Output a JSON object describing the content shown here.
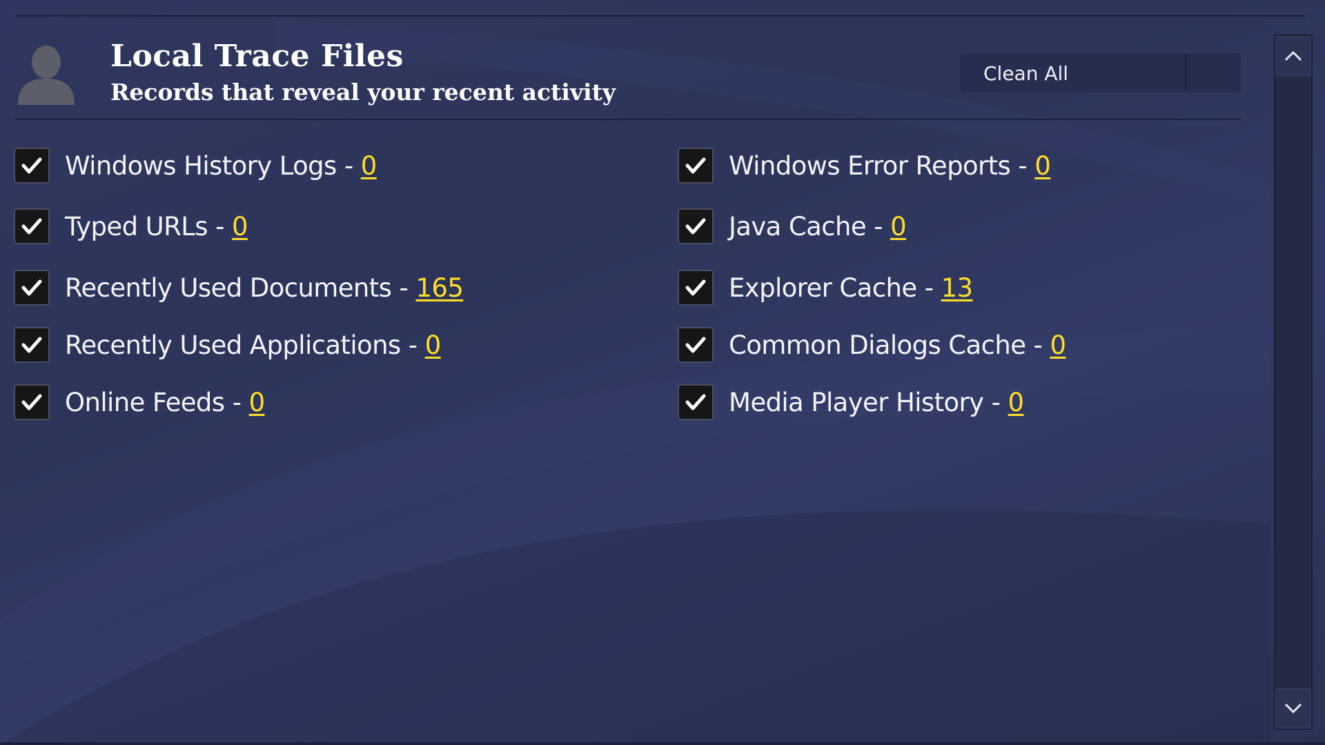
{
  "header": {
    "title": "Local Trace Files",
    "subtitle": "Records that reveal your recent activity",
    "avatar_icon": "user-silhouette-icon",
    "clean_button_label": "Clean All"
  },
  "items": {
    "left": [
      {
        "label": "Windows History Logs",
        "separator": "-",
        "count": "0",
        "checked": true
      },
      {
        "label": "Typed URLs",
        "separator": "-",
        "count": "0",
        "checked": true
      },
      {
        "label": "Recently Used Documents",
        "separator": "-",
        "count": "165",
        "checked": true
      },
      {
        "label": "Recently Used Applications",
        "separator": "-",
        "count": "0",
        "checked": true
      },
      {
        "label": "Online Feeds",
        "separator": "-",
        "count": "0",
        "checked": true
      }
    ],
    "right": [
      {
        "label": "Windows Error Reports",
        "separator": "-",
        "count": "0",
        "checked": true
      },
      {
        "label": "Java Cache",
        "separator": "-",
        "count": "0",
        "checked": true
      },
      {
        "label": "Explorer Cache",
        "separator": "-",
        "count": "13",
        "checked": true
      },
      {
        "label": "Common Dialogs Cache",
        "separator": "-",
        "count": "0",
        "checked": true
      },
      {
        "label": "Media Player History",
        "separator": "-",
        "count": "0",
        "checked": true
      }
    ]
  },
  "scrollbar": {
    "up_icon": "chevron-up-icon",
    "down_icon": "chevron-down-icon"
  },
  "colors": {
    "background": "#2c3459",
    "count_link": "#ffde27",
    "checkbox": "#161616"
  }
}
